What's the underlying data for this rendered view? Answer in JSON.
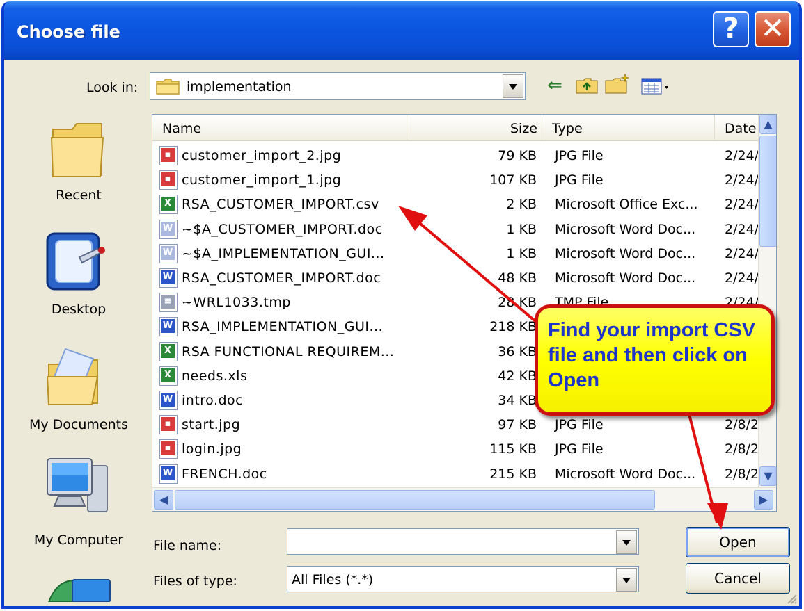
{
  "dialog": {
    "title": "Choose file",
    "help_label": "?",
    "close_label": "✕"
  },
  "lookin": {
    "label": "Look in:",
    "value": "implementation"
  },
  "places": [
    {
      "label": "Recent"
    },
    {
      "label": "Desktop"
    },
    {
      "label": "My Documents"
    },
    {
      "label": "My Computer"
    }
  ],
  "columns": {
    "name": "Name",
    "size": "Size",
    "type": "Type",
    "date": "Date"
  },
  "files": [
    {
      "name": "customer_import_2.jpg",
      "size": "79 KB",
      "type": "JPG File",
      "date": "2/24/:",
      "icon": "jpg"
    },
    {
      "name": "customer_import_1.jpg",
      "size": "107 KB",
      "type": "JPG File",
      "date": "2/24/:",
      "icon": "jpg"
    },
    {
      "name": "RSA_CUSTOMER_IMPORT.csv",
      "size": "2 KB",
      "type": "Microsoft Office Exc...",
      "date": "2/24/:",
      "icon": "xls"
    },
    {
      "name": "~$A_CUSTOMER_IMPORT.doc",
      "size": "1 KB",
      "type": "Microsoft Word Doc...",
      "date": "2/24/:",
      "icon": "doc-light"
    },
    {
      "name": "~$A_IMPLEMENTATION_GUI...",
      "size": "1 KB",
      "type": "Microsoft Word Doc...",
      "date": "2/24/:",
      "icon": "doc-light"
    },
    {
      "name": "RSA_CUSTOMER_IMPORT.doc",
      "size": "48 KB",
      "type": "Microsoft Word Doc...",
      "date": "2/24/:",
      "icon": "doc"
    },
    {
      "name": "~WRL1033.tmp",
      "size": "28 KB",
      "type": "TMP File",
      "date": "2/24/:",
      "icon": "tmp"
    },
    {
      "name": "RSA_IMPLEMENTATION_GUI...",
      "size": "218 KB",
      "type": "",
      "date": "",
      "icon": "doc"
    },
    {
      "name": "RSA FUNCTIONAL REQUIREM...",
      "size": "36 KB",
      "type": "",
      "date": "",
      "icon": "xls"
    },
    {
      "name": "needs.xls",
      "size": "42 KB",
      "type": "",
      "date": "",
      "icon": "xls"
    },
    {
      "name": "intro.doc",
      "size": "34 KB",
      "type": "",
      "date": "",
      "icon": "doc"
    },
    {
      "name": "start.jpg",
      "size": "97 KB",
      "type": "JPG File",
      "date": "2/8/2(",
      "icon": "jpg"
    },
    {
      "name": "login.jpg",
      "size": "115 KB",
      "type": "JPG File",
      "date": "2/8/2(",
      "icon": "jpg"
    },
    {
      "name": "FRENCH.doc",
      "size": "215 KB",
      "type": "Microsoft Word Doc...",
      "date": "2/8/2(",
      "icon": "doc"
    }
  ],
  "filename": {
    "label": "File name:",
    "value": ""
  },
  "filetype": {
    "label": "Files of type:",
    "value": "All Files (*.*)"
  },
  "buttons": {
    "open": "Open",
    "cancel": "Cancel"
  },
  "callout": {
    "text": "Find your import CSV file and then click on Open"
  },
  "colors": {
    "titlebar": "#0a4fd6",
    "callout_fill": "#ffff00",
    "callout_border": "#cc1111",
    "callout_text": "#1d35c8",
    "arrow": "#e01010"
  }
}
